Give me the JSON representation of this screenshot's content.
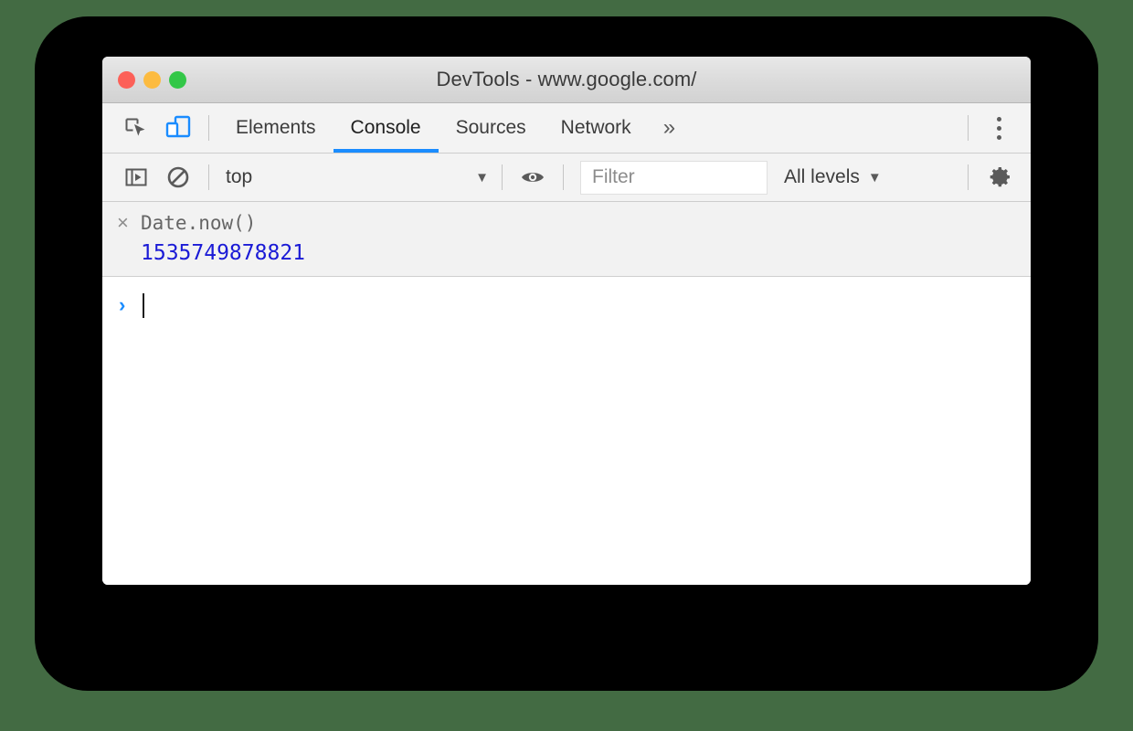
{
  "window": {
    "title": "DevTools - www.google.com/",
    "traffic_lights": [
      {
        "name": "close",
        "color": "#fc6058"
      },
      {
        "name": "minimize",
        "color": "#fcbb40"
      },
      {
        "name": "maximize",
        "color": "#33c748"
      }
    ]
  },
  "tabbar": {
    "inspect_icon": "inspect-element-icon",
    "device_icon": "device-toolbar-icon",
    "tabs": [
      {
        "label": "Elements",
        "active": false
      },
      {
        "label": "Console",
        "active": true
      },
      {
        "label": "Sources",
        "active": false
      },
      {
        "label": "Network",
        "active": false
      }
    ],
    "more_tabs_label": "»",
    "menu_icon": "kebab-menu-icon",
    "active_underline_color": "#1a8cff"
  },
  "console_toolbar": {
    "sidebar_toggle_icon": "console-sidebar-icon",
    "clear_icon": "clear-console-icon",
    "context": {
      "value": "top",
      "caret": "▼"
    },
    "live_expression_icon": "eye-icon",
    "filter": {
      "value": "",
      "placeholder": "Filter"
    },
    "levels": {
      "value": "All levels",
      "caret": "▼"
    },
    "settings_icon": "gear-icon"
  },
  "console": {
    "messages": [
      {
        "dismiss": "×",
        "input": "Date.now()",
        "result": "1535749878821",
        "result_color": "#1a1ad6"
      }
    ],
    "prompt": {
      "chevron": "›",
      "value": ""
    }
  }
}
